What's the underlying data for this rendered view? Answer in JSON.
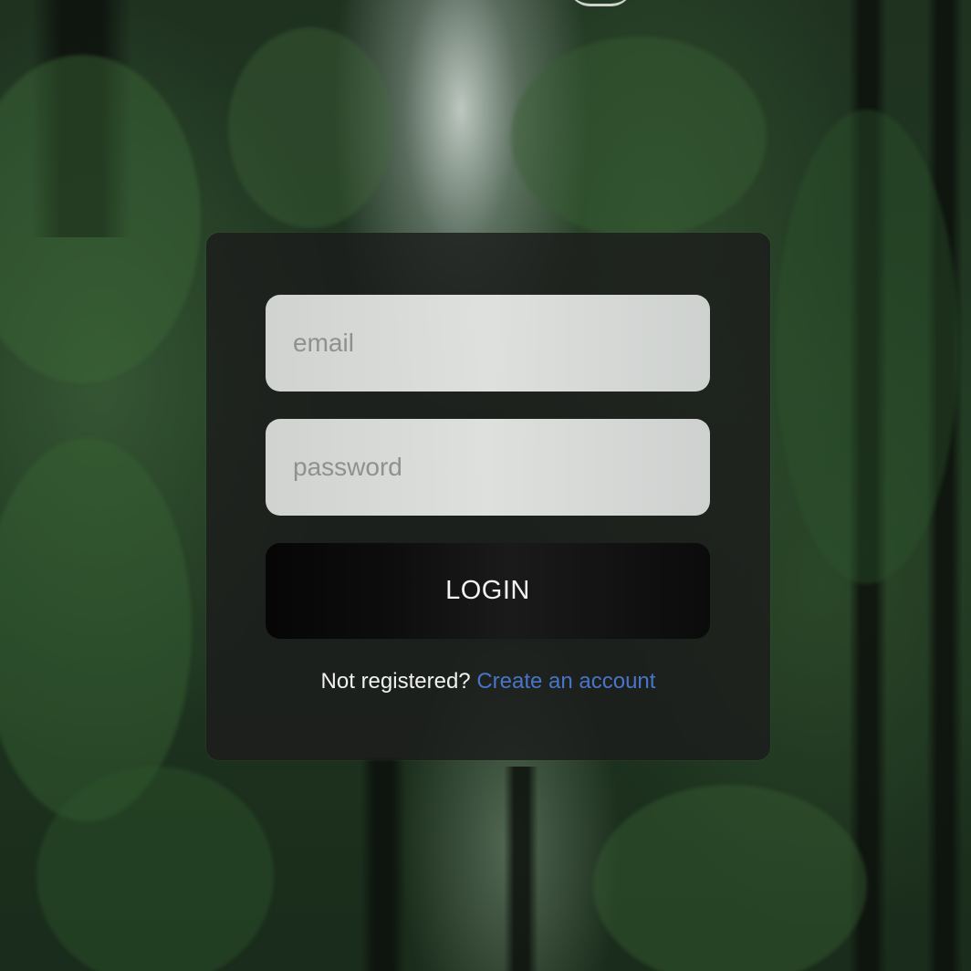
{
  "login_form": {
    "email_placeholder": "email",
    "password_placeholder": "password",
    "login_label": "LOGIN",
    "register_prompt": "Not registered?",
    "create_account_link": "Create an account"
  },
  "colors": {
    "card_background": "#1c1c1c",
    "input_background": "#e6e8e6",
    "button_background": "#0b0b0b",
    "link_color": "#4a74c9"
  }
}
